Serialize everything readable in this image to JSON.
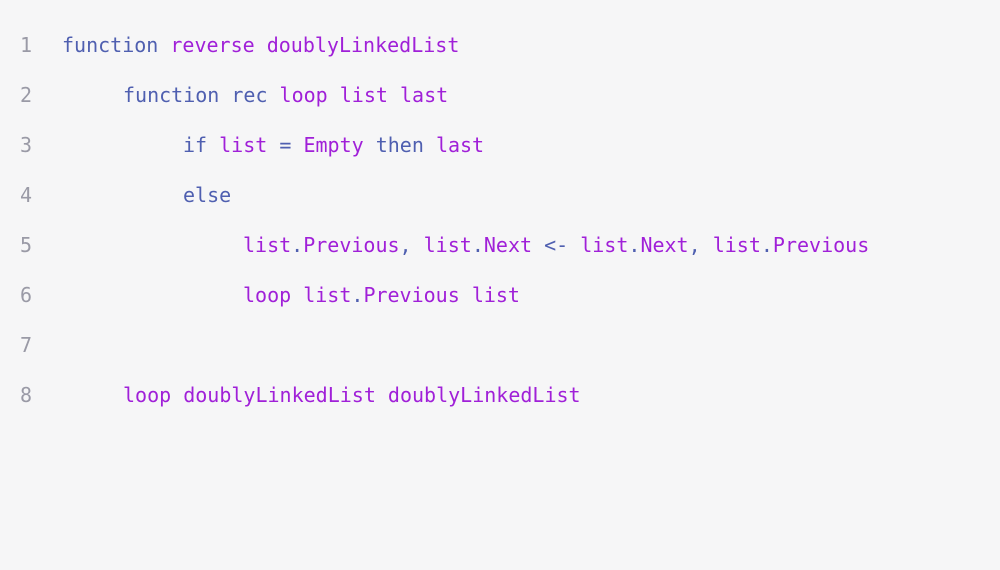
{
  "code": {
    "lines": [
      {
        "number": "1",
        "tokens": [
          {
            "text": "function",
            "kind": "keyword"
          },
          {
            "text": " ",
            "kind": "space"
          },
          {
            "text": "reverse",
            "kind": "ident"
          },
          {
            "text": " ",
            "kind": "space"
          },
          {
            "text": "doublyLinkedList",
            "kind": "ident"
          }
        ]
      },
      {
        "number": "2",
        "tokens": [
          {
            "text": "function",
            "kind": "keyword"
          },
          {
            "text": " ",
            "kind": "space"
          },
          {
            "text": "rec",
            "kind": "keyword"
          },
          {
            "text": " ",
            "kind": "space"
          },
          {
            "text": "loop",
            "kind": "ident"
          },
          {
            "text": " ",
            "kind": "space"
          },
          {
            "text": "list",
            "kind": "ident"
          },
          {
            "text": " ",
            "kind": "space"
          },
          {
            "text": "last",
            "kind": "ident"
          }
        ]
      },
      {
        "number": "3",
        "tokens": [
          {
            "text": "if",
            "kind": "keyword"
          },
          {
            "text": " ",
            "kind": "space"
          },
          {
            "text": "list",
            "kind": "ident"
          },
          {
            "text": " ",
            "kind": "space"
          },
          {
            "text": "=",
            "kind": "op"
          },
          {
            "text": " ",
            "kind": "space"
          },
          {
            "text": "Empty",
            "kind": "ident"
          },
          {
            "text": " ",
            "kind": "space"
          },
          {
            "text": "then",
            "kind": "keyword"
          },
          {
            "text": " ",
            "kind": "space"
          },
          {
            "text": "last",
            "kind": "ident"
          }
        ]
      },
      {
        "number": "4",
        "tokens": [
          {
            "text": "else",
            "kind": "keyword"
          }
        ]
      },
      {
        "number": "5",
        "tokens": [
          {
            "text": "list",
            "kind": "ident"
          },
          {
            "text": ".",
            "kind": "punct"
          },
          {
            "text": "Previous",
            "kind": "ident"
          },
          {
            "text": ",",
            "kind": "punct"
          },
          {
            "text": " ",
            "kind": "space"
          },
          {
            "text": "list",
            "kind": "ident"
          },
          {
            "text": ".",
            "kind": "punct"
          },
          {
            "text": "Next",
            "kind": "ident"
          },
          {
            "text": " ",
            "kind": "space"
          },
          {
            "text": "<-",
            "kind": "op"
          },
          {
            "text": " ",
            "kind": "space"
          },
          {
            "text": "list",
            "kind": "ident"
          },
          {
            "text": ".",
            "kind": "punct"
          },
          {
            "text": "Next",
            "kind": "ident"
          },
          {
            "text": ",",
            "kind": "punct"
          },
          {
            "text": " ",
            "kind": "space"
          },
          {
            "text": "list",
            "kind": "ident"
          },
          {
            "text": ".",
            "kind": "punct"
          },
          {
            "text": "Previous",
            "kind": "ident"
          }
        ]
      },
      {
        "number": "6",
        "tokens": [
          {
            "text": "loop",
            "kind": "ident"
          },
          {
            "text": " ",
            "kind": "space"
          },
          {
            "text": "list",
            "kind": "ident"
          },
          {
            "text": ".",
            "kind": "punct"
          },
          {
            "text": "Previous",
            "kind": "ident"
          },
          {
            "text": " ",
            "kind": "space"
          },
          {
            "text": "list",
            "kind": "ident"
          }
        ]
      },
      {
        "number": "7",
        "tokens": []
      },
      {
        "number": "8",
        "tokens": [
          {
            "text": "loop",
            "kind": "ident"
          },
          {
            "text": " ",
            "kind": "space"
          },
          {
            "text": "doublyLinkedList",
            "kind": "ident"
          },
          {
            "text": " ",
            "kind": "space"
          },
          {
            "text": "doublyLinkedList",
            "kind": "ident"
          }
        ]
      }
    ]
  },
  "colors": {
    "background": "#f6f6f7",
    "keyword": "#4f5fb0",
    "identifier": "#a020d8",
    "line_number": "#9a9aa6"
  }
}
